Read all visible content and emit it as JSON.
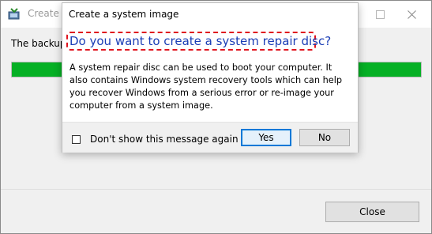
{
  "main_window": {
    "title": "Create a",
    "backup_text": "The backup",
    "progress_fraction": 1.0,
    "close_label": "Close",
    "progress_color": "#06b025"
  },
  "dialog": {
    "title": "Create a system image",
    "heading": "Do you want to create a system repair disc?",
    "body": "A system repair disc can be used to boot your computer. It also contains Windows system recovery tools which can help you recover Windows from a serious error or re-image your computer from a system image.",
    "checkbox_label": "Don't show this message again",
    "checkbox_checked": false,
    "yes_label": "Yes",
    "no_label": "No",
    "heading_color": "#1a3db5",
    "highlight_color": "#e0141e"
  },
  "icons": [
    "backup-app-icon",
    "minimize-icon",
    "maximize-icon",
    "close-icon"
  ]
}
